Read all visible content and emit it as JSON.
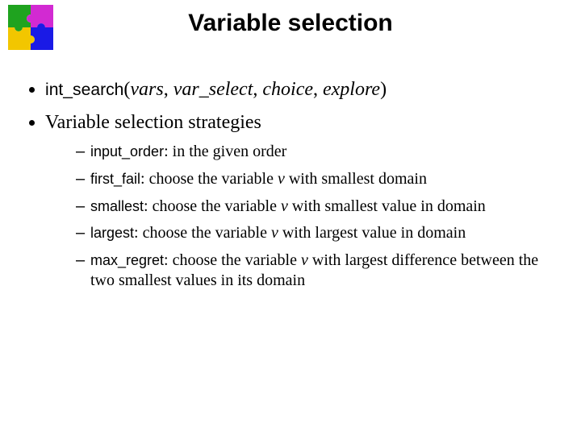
{
  "title": "Variable selection",
  "b1": {
    "fn": "int_search",
    "open": "(",
    "a1": "vars",
    "c1": ", ",
    "a2": "var_select",
    "c2": ", ",
    "a3": "choice",
    "c3": ", ",
    "a4": "explore",
    "close": ")"
  },
  "b2": {
    "text": "Variable selection strategies",
    "items": [
      {
        "kw": "input_order",
        "colon": ": ",
        "rest": "in the given order"
      },
      {
        "kw": "first_fail",
        "colon": ": ",
        "pre": "choose the variable ",
        "var": "v",
        "post": " with smallest domain"
      },
      {
        "kw": "smallest",
        "colon": ": ",
        "pre": "choose the variable ",
        "var": "v",
        "post": " with smallest value in domain"
      },
      {
        "kw": "largest",
        "colon": ": ",
        "pre": "choose the variable ",
        "var": "v",
        "post": " with largest value in domain"
      },
      {
        "kw": "max_regret",
        "colon": ": ",
        "pre": "choose the variable ",
        "var": "v",
        "post": " with largest difference between the two smallest values in its domain"
      }
    ]
  }
}
